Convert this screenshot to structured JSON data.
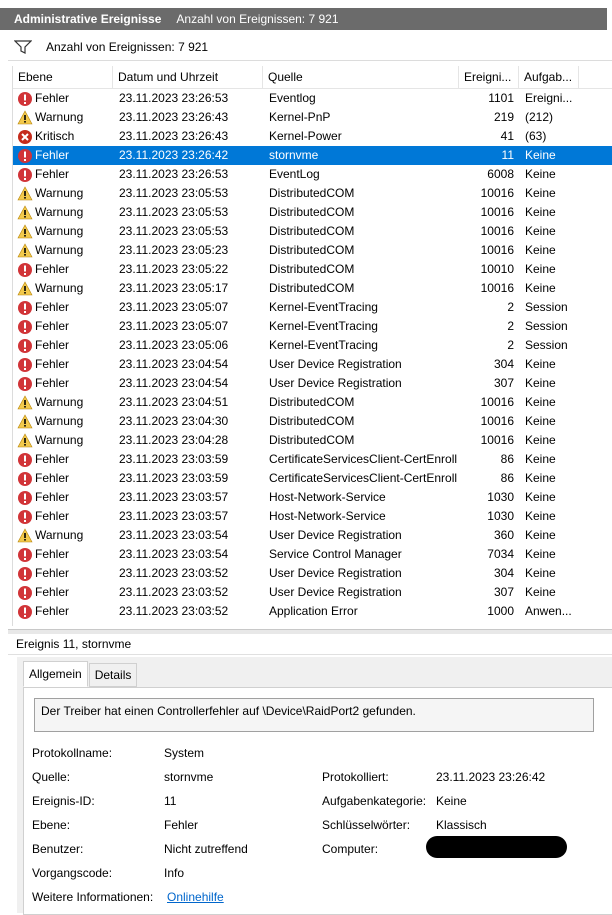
{
  "title_bar": {
    "title": "Administrative Ereignisse",
    "count_text": "Anzahl von Ereignissen: 7 921"
  },
  "filter_bar": {
    "icon": "filter-icon",
    "count_text": "Anzahl von Ereignissen: 7 921"
  },
  "columns": {
    "level": "Ebene",
    "date": "Datum und Uhrzeit",
    "source": "Quelle",
    "event_id": "Ereigni...",
    "category": "Aufgab..."
  },
  "colors": {
    "selected": "#0078d7",
    "error": "#d13438",
    "warning": "#f2c94c",
    "titlebar": "#6b6b6b"
  },
  "events": [
    {
      "type": "error",
      "level": "Fehler",
      "date": "23.11.2023 23:26:53",
      "source": "Eventlog",
      "id": "1101",
      "cat": "Ereigni..."
    },
    {
      "type": "warning",
      "level": "Warnung",
      "date": "23.11.2023 23:26:43",
      "source": "Kernel-PnP",
      "id": "219",
      "cat": "(212)"
    },
    {
      "type": "critical",
      "level": "Kritisch",
      "date": "23.11.2023 23:26:43",
      "source": "Kernel-Power",
      "id": "41",
      "cat": "(63)"
    },
    {
      "type": "error",
      "level": "Fehler",
      "date": "23.11.2023 23:26:42",
      "source": "stornvme",
      "id": "11",
      "cat": "Keine",
      "selected": true
    },
    {
      "type": "error",
      "level": "Fehler",
      "date": "23.11.2023 23:26:53",
      "source": "EventLog",
      "id": "6008",
      "cat": "Keine"
    },
    {
      "type": "warning",
      "level": "Warnung",
      "date": "23.11.2023 23:05:53",
      "source": "DistributedCOM",
      "id": "10016",
      "cat": "Keine"
    },
    {
      "type": "warning",
      "level": "Warnung",
      "date": "23.11.2023 23:05:53",
      "source": "DistributedCOM",
      "id": "10016",
      "cat": "Keine"
    },
    {
      "type": "warning",
      "level": "Warnung",
      "date": "23.11.2023 23:05:53",
      "source": "DistributedCOM",
      "id": "10016",
      "cat": "Keine"
    },
    {
      "type": "warning",
      "level": "Warnung",
      "date": "23.11.2023 23:05:23",
      "source": "DistributedCOM",
      "id": "10016",
      "cat": "Keine"
    },
    {
      "type": "error",
      "level": "Fehler",
      "date": "23.11.2023 23:05:22",
      "source": "DistributedCOM",
      "id": "10010",
      "cat": "Keine"
    },
    {
      "type": "warning",
      "level": "Warnung",
      "date": "23.11.2023 23:05:17",
      "source": "DistributedCOM",
      "id": "10016",
      "cat": "Keine"
    },
    {
      "type": "error",
      "level": "Fehler",
      "date": "23.11.2023 23:05:07",
      "source": "Kernel-EventTracing",
      "id": "2",
      "cat": "Session"
    },
    {
      "type": "error",
      "level": "Fehler",
      "date": "23.11.2023 23:05:07",
      "source": "Kernel-EventTracing",
      "id": "2",
      "cat": "Session"
    },
    {
      "type": "error",
      "level": "Fehler",
      "date": "23.11.2023 23:05:06",
      "source": "Kernel-EventTracing",
      "id": "2",
      "cat": "Session"
    },
    {
      "type": "error",
      "level": "Fehler",
      "date": "23.11.2023 23:04:54",
      "source": "User Device Registration",
      "id": "304",
      "cat": "Keine"
    },
    {
      "type": "error",
      "level": "Fehler",
      "date": "23.11.2023 23:04:54",
      "source": "User Device Registration",
      "id": "307",
      "cat": "Keine"
    },
    {
      "type": "warning",
      "level": "Warnung",
      "date": "23.11.2023 23:04:51",
      "source": "DistributedCOM",
      "id": "10016",
      "cat": "Keine"
    },
    {
      "type": "warning",
      "level": "Warnung",
      "date": "23.11.2023 23:04:30",
      "source": "DistributedCOM",
      "id": "10016",
      "cat": "Keine"
    },
    {
      "type": "warning",
      "level": "Warnung",
      "date": "23.11.2023 23:04:28",
      "source": "DistributedCOM",
      "id": "10016",
      "cat": "Keine"
    },
    {
      "type": "error",
      "level": "Fehler",
      "date": "23.11.2023 23:03:59",
      "source": "CertificateServicesClient-CertEnroll",
      "id": "86",
      "cat": "Keine"
    },
    {
      "type": "error",
      "level": "Fehler",
      "date": "23.11.2023 23:03:59",
      "source": "CertificateServicesClient-CertEnroll",
      "id": "86",
      "cat": "Keine"
    },
    {
      "type": "error",
      "level": "Fehler",
      "date": "23.11.2023 23:03:57",
      "source": "Host-Network-Service",
      "id": "1030",
      "cat": "Keine"
    },
    {
      "type": "error",
      "level": "Fehler",
      "date": "23.11.2023 23:03:57",
      "source": "Host-Network-Service",
      "id": "1030",
      "cat": "Keine"
    },
    {
      "type": "warning",
      "level": "Warnung",
      "date": "23.11.2023 23:03:54",
      "source": "User Device Registration",
      "id": "360",
      "cat": "Keine"
    },
    {
      "type": "error",
      "level": "Fehler",
      "date": "23.11.2023 23:03:54",
      "source": "Service Control Manager",
      "id": "7034",
      "cat": "Keine"
    },
    {
      "type": "error",
      "level": "Fehler",
      "date": "23.11.2023 23:03:52",
      "source": "User Device Registration",
      "id": "304",
      "cat": "Keine"
    },
    {
      "type": "error",
      "level": "Fehler",
      "date": "23.11.2023 23:03:52",
      "source": "User Device Registration",
      "id": "307",
      "cat": "Keine"
    },
    {
      "type": "error",
      "level": "Fehler",
      "date": "23.11.2023 23:03:52",
      "source": "Application Error",
      "id": "1000",
      "cat": "Anwen..."
    }
  ],
  "detail": {
    "title": "Ereignis 11, stornvme",
    "tabs": [
      "Allgemein",
      "Details"
    ],
    "message": "Der Treiber hat einen Controllerfehler auf \\Device\\RaidPort2 gefunden.",
    "fields": {
      "log_name_label": "Protokollname:",
      "log_name": "System",
      "source_label": "Quelle:",
      "source": "stornvme",
      "logged_label": "Protokolliert:",
      "logged": "23.11.2023 23:26:42",
      "event_id_label": "Ereignis-ID:",
      "event_id": "11",
      "task_cat_label": "Aufgabenkategorie:",
      "task_cat": "Keine",
      "level_label": "Ebene:",
      "level": "Fehler",
      "keywords_label": "Schlüsselwörter:",
      "keywords": "Klassisch",
      "user_label": "Benutzer:",
      "user": "Nicht zutreffend",
      "computer_label": "Computer:",
      "opcode_label": "Vorgangscode:",
      "opcode": "Info",
      "more_info_label": "Weitere Informationen:",
      "more_info_link": "Onlinehilfe"
    }
  }
}
